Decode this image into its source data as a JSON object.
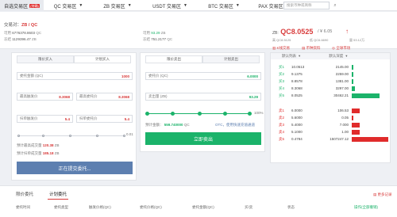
{
  "nav": {
    "tabs": [
      {
        "label": "自选交易区",
        "badge": "",
        "active": true
      },
      {
        "label": "QC 交易区",
        "badge": "",
        "active": false
      },
      {
        "label": "ZB 交易区",
        "badge": "",
        "active": false
      },
      {
        "label": "USDT 交易区",
        "badge": "",
        "active": false
      },
      {
        "label": "BTC 交易区",
        "badge": "",
        "active": false
      },
      {
        "label": "PAX 交易区",
        "badge": "",
        "active": false
      }
    ],
    "first_badge": "(待确)",
    "search_placeholder": "搜索币种或简称"
  },
  "header": {
    "pair_prefix": "交易对：",
    "pair": "ZB / QC",
    "rows": [
      {
        "label": "可用",
        "value": "6776378.8603",
        "unit": "QC"
      },
      {
        "label": "冻结",
        "value": "1129396.47",
        "unit": "ZB"
      }
    ],
    "rows_right": [
      {
        "label": "可用",
        "value": "93.29",
        "unit": "ZB"
      },
      {
        "label": "冻结",
        "value": "751.2177",
        "unit": "QC"
      }
    ],
    "price_prefix": "ZB:",
    "price": "QC8.0525",
    "price_sub": "/ ¥ 6.05",
    "stats": [
      {
        "label": "高",
        "value": "QC8.5125"
      },
      {
        "label": "低",
        "value": "QC6.6690"
      },
      {
        "label": "量",
        "value": "53.12万"
      }
    ],
    "links": [
      "K线交易",
      "币种资料",
      "全球市场"
    ]
  },
  "buy": {
    "tabs": [
      "限价买入",
      "计划买入"
    ],
    "price_label": "委托金额 (QC)",
    "price_value": "1000",
    "trigger_label": "最高触发价",
    "trigger_value": "8.3068",
    "trigger2_label": "最高委托价",
    "trigger2_value": "8.3068",
    "low_label": "扫单触发价",
    "low_value": "5.4",
    "low2_label": "扫单委托价",
    "low2_value": "5.4",
    "slider_end": "0.01",
    "fee_label": "预计最高成交量",
    "fee_value": "120.38",
    "fee_unit": "ZB",
    "fee2_label": "预计扫单成交量",
    "fee2_value": "185.18",
    "fee2_unit": "ZB",
    "button": "正在提交委托...",
    "button_color": "#5d7fb0"
  },
  "sell": {
    "tabs": [
      "限价卖出",
      "计划卖出"
    ],
    "price_label": "委托价 (QC)",
    "price_value": "6.0000",
    "amount_label": "卖出量 (ZB)",
    "amount_value": "93.29",
    "slider_end": "100%",
    "est_label": "预计金额：",
    "est_value": "559.740000",
    "est_unit": "QC",
    "est_note": "OTC，使用快速充值通道",
    "button": "立即卖出",
    "button_color": "#1bb36a"
  },
  "orderbook": {
    "head_left": "默认列表",
    "head_right": "默认深度",
    "buys": [
      {
        "label": "买1",
        "price": "10.0513",
        "amount": "2145.00",
        "bar": 0.05
      },
      {
        "label": "买2",
        "price": "9.1375",
        "amount": "2259.00",
        "bar": 0.05
      },
      {
        "label": "买3",
        "price": "8.8578",
        "amount": "1381.00",
        "bar": 0.03
      },
      {
        "label": "买4",
        "price": "8.3068",
        "amount": "3297.00",
        "bar": 0.08
      },
      {
        "label": "买5",
        "price": "8.0525",
        "amount": "30462.21",
        "bar": 0.75
      }
    ],
    "sells": [
      {
        "label": "卖1",
        "price": "6.0000",
        "amount": "106.53",
        "bar": 0.22
      },
      {
        "label": "卖2",
        "price": "5.6000",
        "amount": "0.05",
        "bar": 0.05
      },
      {
        "label": "卖3",
        "price": "5.4000",
        "amount": "7.000",
        "bar": 0.22
      },
      {
        "label": "卖4",
        "price": "5.1000",
        "amount": "1.00",
        "bar": 0.22
      },
      {
        "label": "卖5",
        "price": "0.4784",
        "amount": "1507247.12",
        "bar": 1.0
      }
    ],
    "buy_color": "#1bb36a",
    "sell_color": "#e02b2b"
  },
  "bottom": {
    "tabs": [
      "限价委托",
      "计划委托"
    ],
    "active_tab": 1,
    "more": "更多记录",
    "columns": [
      "委托时间",
      "委托类型",
      "触发价格(QC)",
      "委托价格(QC)",
      "委托金额(QC)",
      "买/卖",
      "状态",
      "操作(全部撤销)"
    ]
  }
}
